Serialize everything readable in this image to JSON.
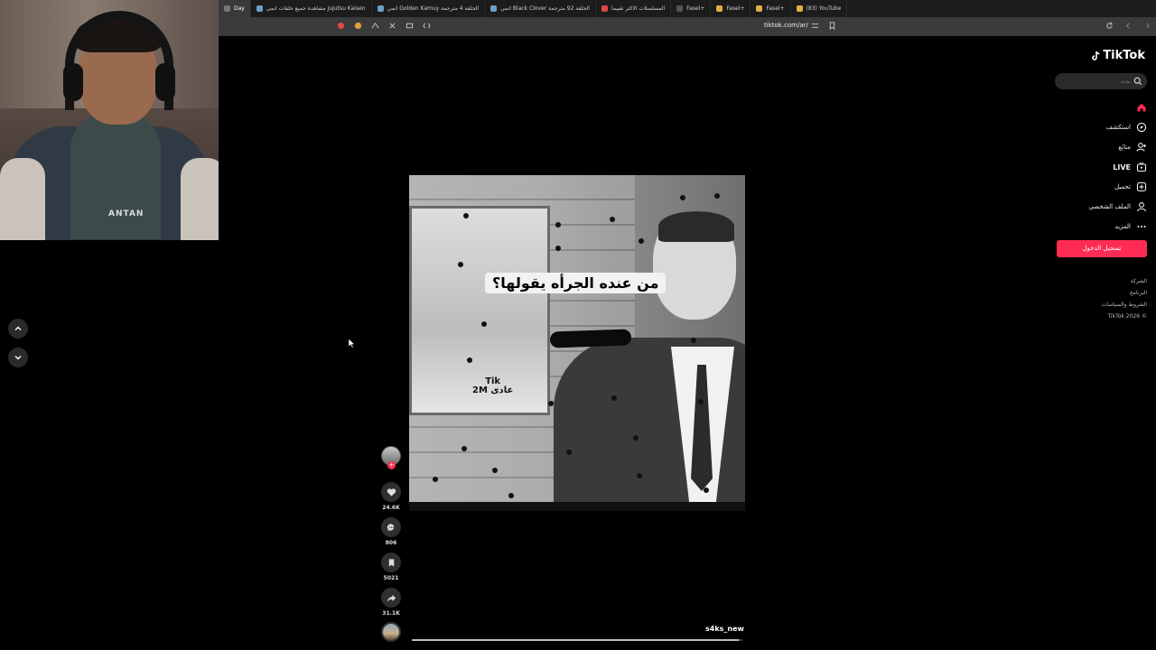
{
  "browser": {
    "tabs": [
      {
        "label": "Day",
        "color": "#777777",
        "active": true
      },
      {
        "label": "مشاهدة جميع حلقات انمي Jujutsu Kaisen",
        "color": "#6aa0c8",
        "active": false
      },
      {
        "label": "انمي Golden Kamuy الحلقة 4 مترجمة",
        "color": "#6aa0c8",
        "active": false
      },
      {
        "label": "انمي Black Clover الحلقة 92 مترجمة",
        "color": "#6aa0c8",
        "active": false
      },
      {
        "label": "المسلسلات الاكثر تقييما",
        "color": "#e04646",
        "active": false
      },
      {
        "label": "Fasel+",
        "color": "#555555",
        "active": false
      },
      {
        "label": "Fasel+",
        "color": "#e0b040",
        "active": false
      },
      {
        "label": "Fasel+",
        "color": "#e0b040",
        "active": false
      },
      {
        "label": "(83) YouTube",
        "color": "#e0b040",
        "active": false
      }
    ],
    "url": "tiktok.com/ar/"
  },
  "webcam": {
    "shirt_text": "ANTAN"
  },
  "video": {
    "caption": "من عنده الجرأه يقولها؟",
    "watermark_line1": "Tik",
    "watermark_line2": "2M عادی",
    "username": "s4ks_new",
    "progress": 0.99
  },
  "actions": {
    "likes": "24.6K",
    "comments": "806",
    "saves": "5021",
    "shares": "31.1K"
  },
  "sidebar": {
    "logo": "TikTok",
    "search_placeholder": "بحث",
    "nav": [
      {
        "label": "",
        "icon": "home-icon",
        "active": true
      },
      {
        "label": "استكشف",
        "icon": "compass-icon",
        "active": false
      },
      {
        "label": "متابَع",
        "icon": "following-icon",
        "active": false
      },
      {
        "label": "LIVE",
        "icon": "live-icon",
        "active": false
      },
      {
        "label": "تحميل",
        "icon": "upload-icon",
        "active": false
      },
      {
        "label": "الملف الشخصي",
        "icon": "profile-icon",
        "active": false
      },
      {
        "label": "المزيد",
        "icon": "more-icon",
        "active": false
      }
    ],
    "login_label": "تسجيل الدخول",
    "footer": [
      "الشركة",
      "البرنامج",
      "الشروط والسياسات",
      "© 2026 TikTok"
    ]
  },
  "colors": {
    "accent": "#fe2c55",
    "background": "#000000"
  }
}
